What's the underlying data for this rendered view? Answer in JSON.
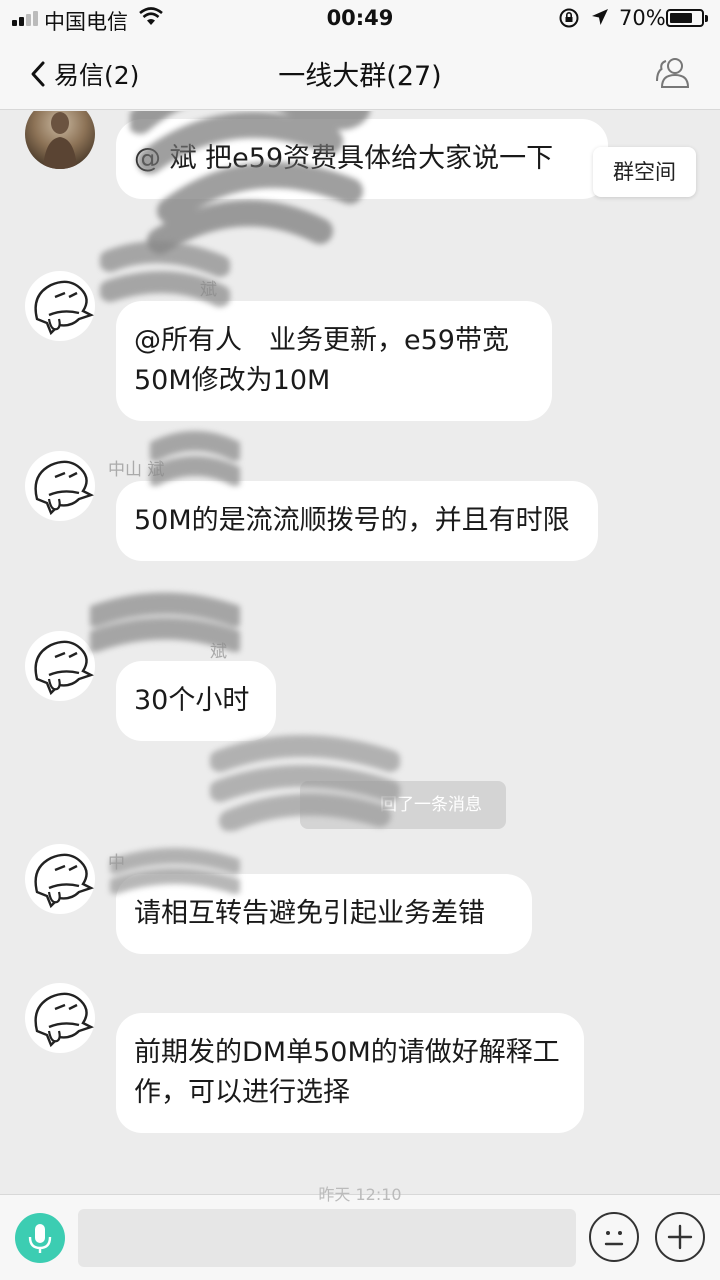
{
  "status_bar": {
    "carrier": "中国电信",
    "time": "00:49",
    "battery": "70%",
    "battery_level": 0.7
  },
  "nav": {
    "back_label": "易信(2)",
    "title": "一线大群(27)",
    "group_space_label": "群空间"
  },
  "messages": [
    {
      "sender": "",
      "text": "@ 斌 把e59资费具体给大家说一下"
    },
    {
      "sender": "斌",
      "text": "@所有人　业务更新，e59带宽50M修改为10M"
    },
    {
      "sender": "中山 斌",
      "text": "50M的是流流顺拨号的，并且有时限"
    },
    {
      "sender": "斌",
      "text": "30个小时"
    },
    {
      "sender": "中",
      "text": "请相互转告避免引起业务差错"
    },
    {
      "sender": "",
      "text": "前期发的DM单50M的请做好解释工作，可以进行选择"
    }
  ],
  "system_notice": "回了一条消息",
  "input_bar": {
    "timestamp": "昨天 12:10",
    "placeholder": ""
  },
  "colors": {
    "background": "#ececec",
    "bubble": "#ffffff",
    "mic_accent": "#3ccdb2"
  },
  "icons": {
    "back": "chevron-left-icon",
    "members": "group-members-icon",
    "mic": "microphone-icon",
    "emoji": "emoji-icon",
    "plus": "plus-icon"
  }
}
